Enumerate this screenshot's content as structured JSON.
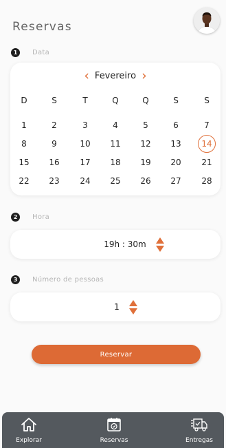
{
  "header": {
    "title": "Reservas"
  },
  "sections": {
    "date": {
      "number": "1",
      "label": "Data"
    },
    "time": {
      "number": "2",
      "label": "Hora"
    },
    "people": {
      "number": "3",
      "label": "Número de pessoas"
    }
  },
  "calendar": {
    "month": "Fevereiro",
    "prev_icon": "chevron-left-icon",
    "next_icon": "chevron-right-icon",
    "weekdays": [
      "D",
      "S",
      "T",
      "Q",
      "Q",
      "S",
      "S"
    ],
    "weeks": [
      [
        "1",
        "2",
        "3",
        "4",
        "5",
        "6",
        "7"
      ],
      [
        "8",
        "9",
        "10",
        "11",
        "12",
        "13",
        "14"
      ],
      [
        "15",
        "16",
        "17",
        "18",
        "19",
        "20",
        "21"
      ],
      [
        "22",
        "23",
        "24",
        "25",
        "26",
        "27",
        "28"
      ]
    ],
    "selected_day": "14"
  },
  "time_picker": {
    "value": "19h : 30m"
  },
  "people_picker": {
    "value": "1"
  },
  "reserve_button": {
    "label": "Reservar"
  },
  "tabbar": {
    "items": [
      {
        "label": "Explorar",
        "icon": "home-icon"
      },
      {
        "label": "Reservas",
        "icon": "calendar-icon"
      },
      {
        "label": "Entregas",
        "icon": "delivery-truck-icon"
      }
    ]
  },
  "colors": {
    "accent": "#dd6a35",
    "tabbar": "#54595e",
    "background": "#fafafa"
  }
}
